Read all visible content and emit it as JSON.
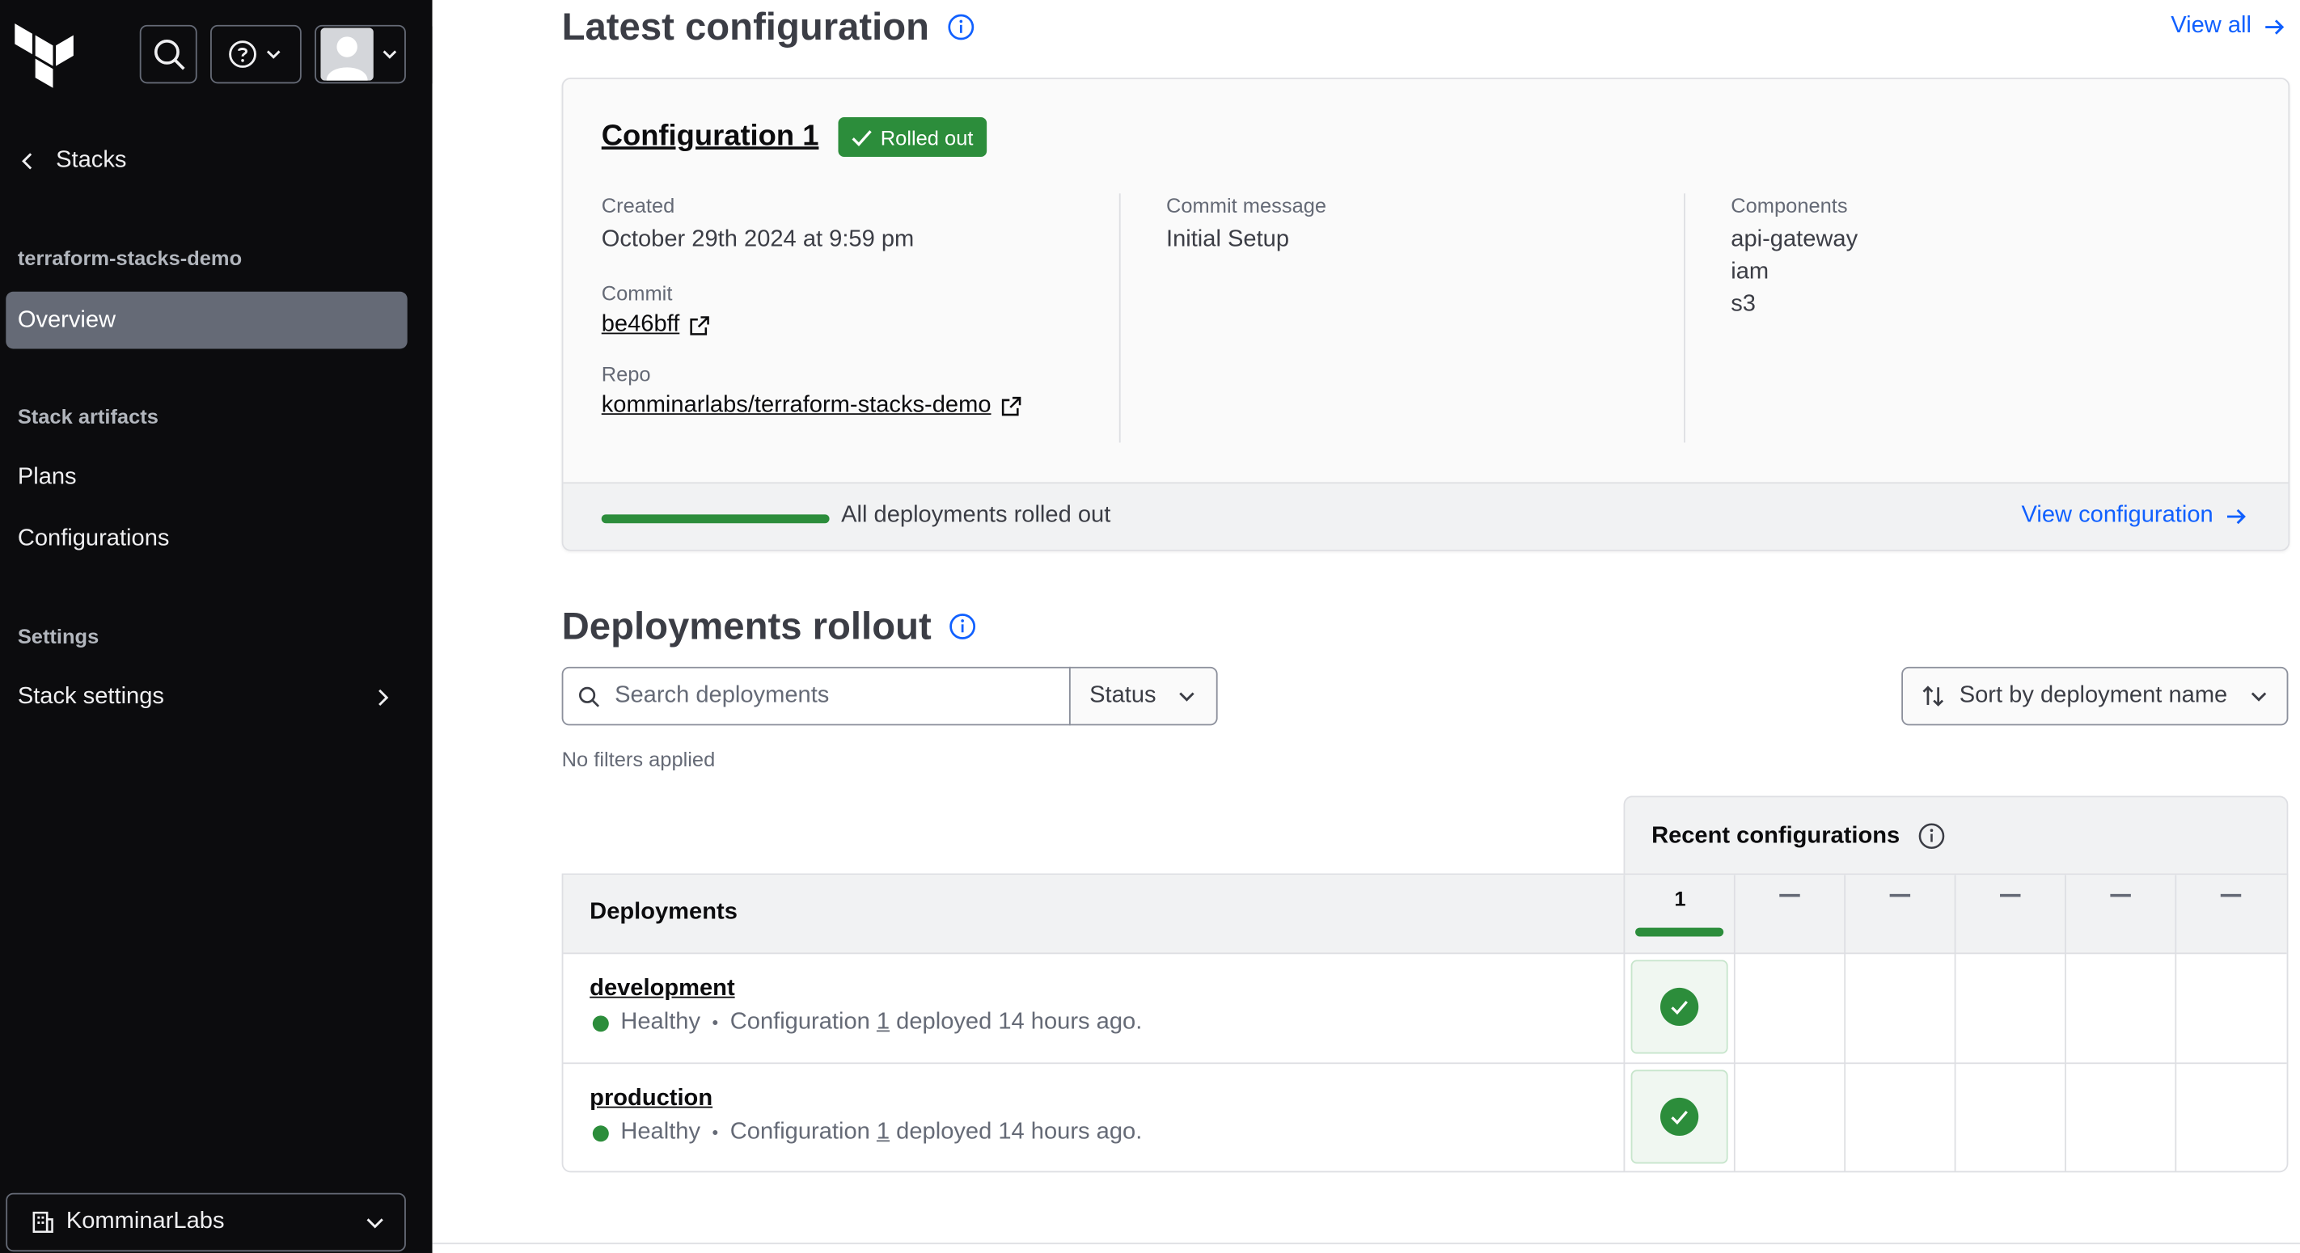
{
  "sidebar": {
    "back_label": "Stacks",
    "project_name": "terraform-stacks-demo",
    "overview_label": "Overview",
    "artifacts_heading": "Stack artifacts",
    "plans_label": "Plans",
    "configurations_label": "Configurations",
    "settings_heading": "Settings",
    "stack_settings_label": "Stack settings",
    "org_name": "KomminarLabs"
  },
  "latest": {
    "title": "Latest configuration",
    "view_all_label": "View all",
    "config_name": "Configuration 1",
    "badge_label": "Rolled out",
    "created_label": "Created",
    "created_value": "October 29th 2024 at 9:59 pm",
    "commit_label": "Commit",
    "commit_value": "be46bff",
    "repo_label": "Repo",
    "repo_value": "komminarlabs/terraform-stacks-demo",
    "commit_message_label": "Commit message",
    "commit_message_value": "Initial Setup",
    "components_label": "Components",
    "components": [
      "api-gateway",
      "iam",
      "s3"
    ],
    "footer_text": "All deployments rolled out",
    "rollout_progress_percent": 100,
    "view_configuration_label": "View configuration"
  },
  "rollout": {
    "title": "Deployments rollout",
    "search_placeholder": "Search deployments",
    "status_label": "Status",
    "sort_label": "Sort by deployment name",
    "no_filters": "No filters applied",
    "recent_configurations_label": "Recent configurations",
    "deployments_header": "Deployments",
    "config_columns": [
      "1",
      "",
      "",
      "",
      "",
      ""
    ],
    "rows": [
      {
        "name": "development",
        "status": "Healthy",
        "config_prefix": "Configuration ",
        "config_num": "1",
        "config_suffix": " deployed 14 hours ago."
      },
      {
        "name": "production",
        "status": "Healthy",
        "config_prefix": "Configuration ",
        "config_num": "1",
        "config_suffix": " deployed 14 hours ago."
      }
    ]
  },
  "colors": {
    "accent": "#1060ff",
    "success": "#2c8d3b",
    "sidebar_bg": "#0c0c0e",
    "sidebar_active": "#656a76"
  }
}
